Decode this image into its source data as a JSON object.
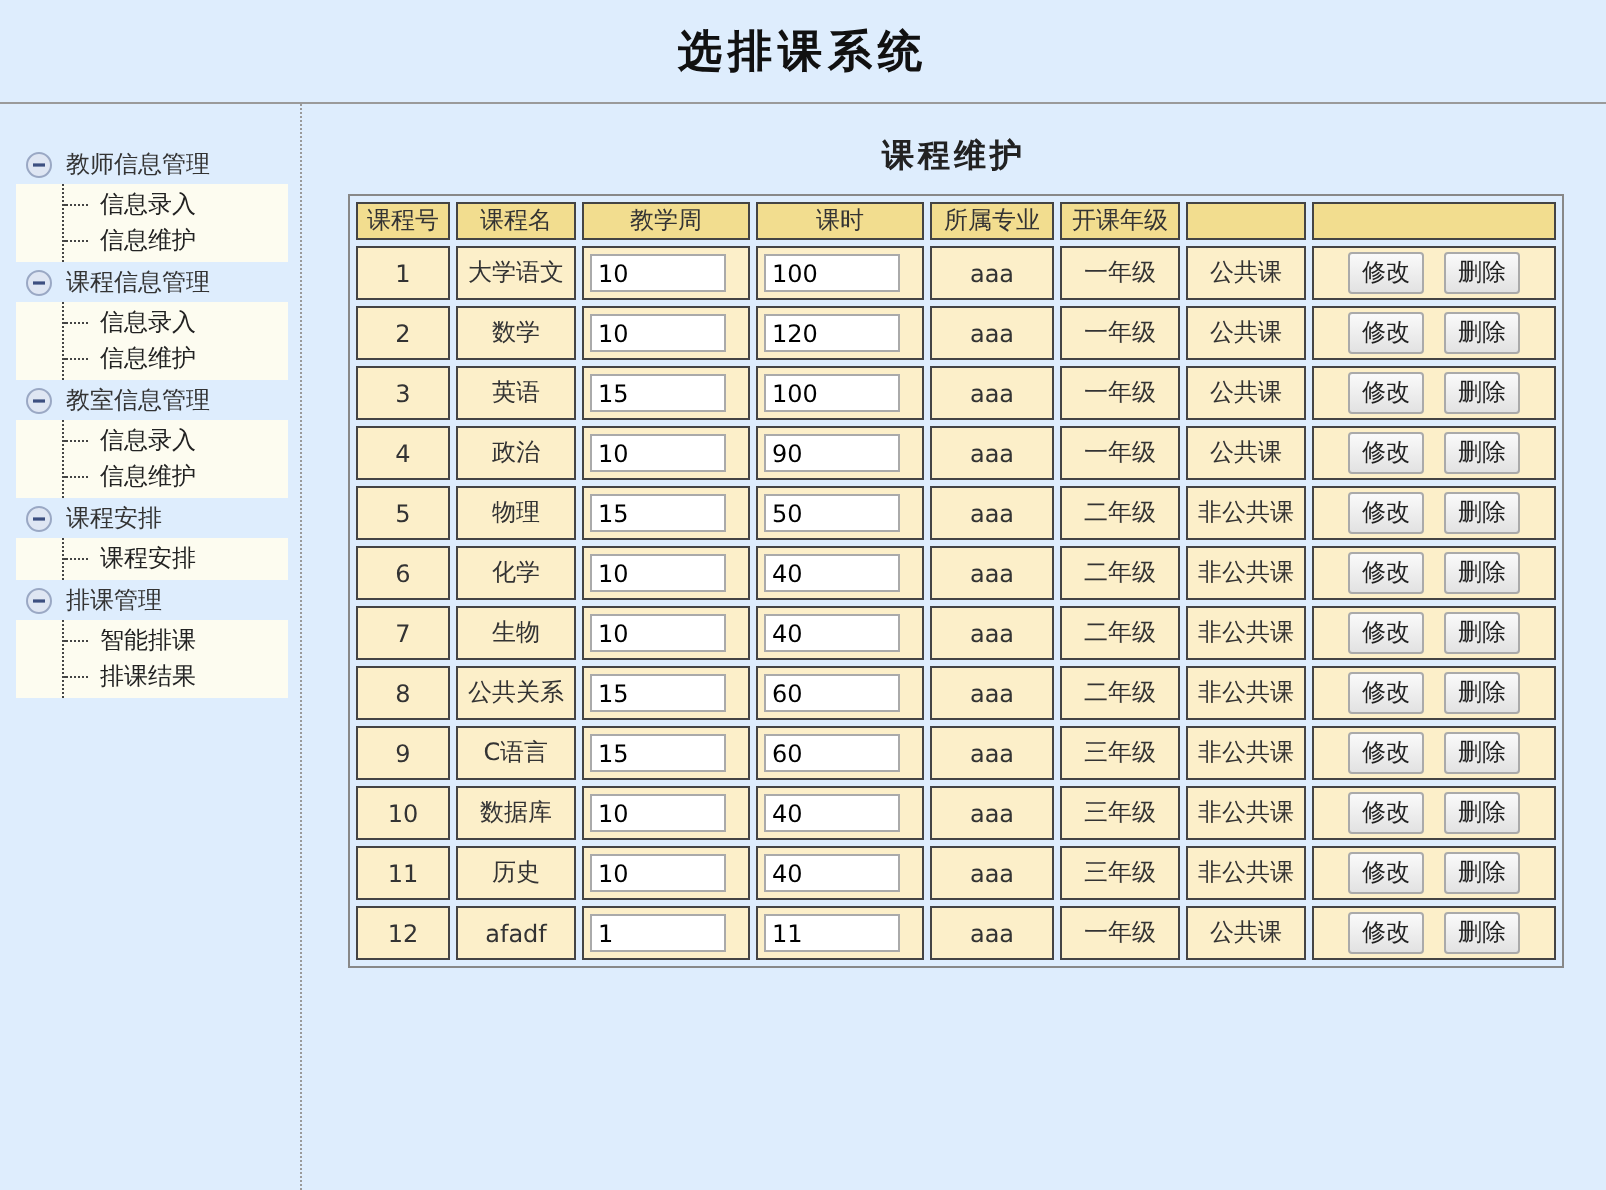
{
  "header": {
    "title": "选排课系统"
  },
  "sidebar": {
    "groups": [
      {
        "label": "教师信息管理",
        "expanded": true,
        "items": [
          "信息录入",
          "信息维护"
        ]
      },
      {
        "label": "课程信息管理",
        "expanded": true,
        "items": [
          "信息录入",
          "信息维护"
        ]
      },
      {
        "label": "教室信息管理",
        "expanded": true,
        "items": [
          "信息录入",
          "信息维护"
        ]
      },
      {
        "label": "课程安排",
        "expanded": true,
        "items": [
          "课程安排"
        ]
      },
      {
        "label": "排课管理",
        "expanded": true,
        "items": [
          "智能排课",
          "排课结果"
        ]
      }
    ]
  },
  "content": {
    "title": "课程维护",
    "table": {
      "columns": [
        "课程号",
        "课程名",
        "教学周",
        "课时",
        "所属专业",
        "开课年级"
      ],
      "rows": [
        {
          "id": "1",
          "name": "大学语文",
          "weeks": "10",
          "hours": "100",
          "major": "aaa",
          "grade": "一年级",
          "type": "公共课",
          "actions": [
            "修改",
            "删除"
          ]
        },
        {
          "id": "2",
          "name": "数学",
          "weeks": "10",
          "hours": "120",
          "major": "aaa",
          "grade": "一年级",
          "type": "公共课",
          "actions": [
            "修改",
            "删除"
          ]
        },
        {
          "id": "3",
          "name": "英语",
          "weeks": "15",
          "hours": "100",
          "major": "aaa",
          "grade": "一年级",
          "type": "公共课",
          "actions": [
            "修改",
            "删除"
          ]
        },
        {
          "id": "4",
          "name": "政治",
          "weeks": "10",
          "hours": "90",
          "major": "aaa",
          "grade": "一年级",
          "type": "公共课",
          "actions": [
            "修改",
            "删除"
          ]
        },
        {
          "id": "5",
          "name": "物理",
          "weeks": "15",
          "hours": "50",
          "major": "aaa",
          "grade": "二年级",
          "type": "非公共课",
          "actions": [
            "修改",
            "删除"
          ]
        },
        {
          "id": "6",
          "name": "化学",
          "weeks": "10",
          "hours": "40",
          "major": "aaa",
          "grade": "二年级",
          "type": "非公共课",
          "actions": [
            "修改",
            "删除"
          ]
        },
        {
          "id": "7",
          "name": "生物",
          "weeks": "10",
          "hours": "40",
          "major": "aaa",
          "grade": "二年级",
          "type": "非公共课",
          "actions": [
            "修改",
            "删除"
          ]
        },
        {
          "id": "8",
          "name": "公共关系",
          "weeks": "15",
          "hours": "60",
          "major": "aaa",
          "grade": "二年级",
          "type": "非公共课",
          "actions": [
            "修改",
            "删除"
          ]
        },
        {
          "id": "9",
          "name": "C语言",
          "weeks": "15",
          "hours": "60",
          "major": "aaa",
          "grade": "三年级",
          "type": "非公共课",
          "actions": [
            "修改",
            "删除"
          ]
        },
        {
          "id": "10",
          "name": "数据库",
          "weeks": "10",
          "hours": "40",
          "major": "aaa",
          "grade": "三年级",
          "type": "非公共课",
          "actions": [
            "修改",
            "删除"
          ]
        },
        {
          "id": "11",
          "name": "历史",
          "weeks": "10",
          "hours": "40",
          "major": "aaa",
          "grade": "三年级",
          "type": "非公共课",
          "actions": [
            "修改",
            "删除"
          ]
        },
        {
          "id": "12",
          "name": "afadf",
          "weeks": "1",
          "hours": "11",
          "major": "aaa",
          "grade": "一年级",
          "type": "公共课",
          "actions": [
            "修改",
            "删除"
          ]
        }
      ]
    }
  }
}
